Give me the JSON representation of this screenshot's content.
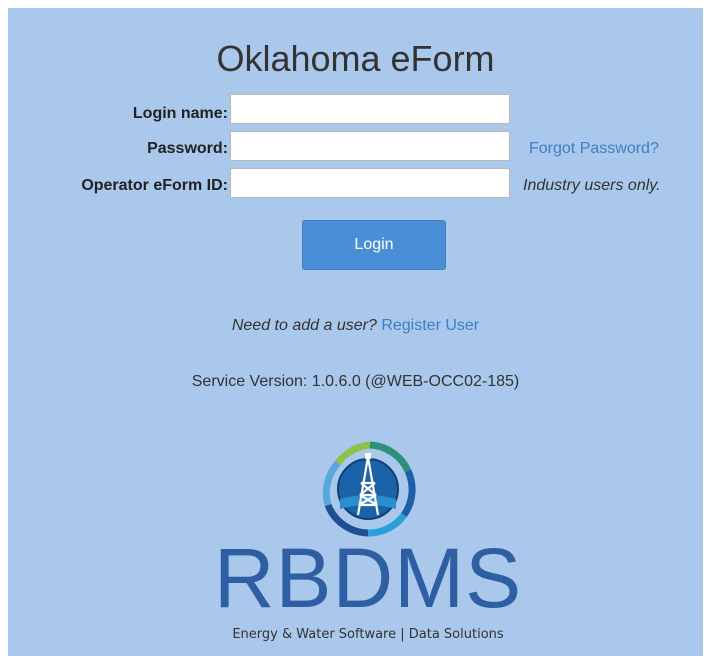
{
  "page": {
    "title": "Oklahoma eForm"
  },
  "form": {
    "login_name": {
      "label": "Login name:",
      "value": ""
    },
    "password": {
      "label": "Password:",
      "value": ""
    },
    "operator_id": {
      "label": "Operator eForm ID:",
      "value": ""
    },
    "forgot_password": "Forgot Password?",
    "industry_hint": "Industry users only.",
    "login_button": "Login"
  },
  "register": {
    "prompt": "Need to add a user?",
    "link": "Register User"
  },
  "service_version": "Service Version: 1.0.6.0 (@WEB-OCC02-185)",
  "logo": {
    "brand": "RBDMS",
    "tagline": "Energy & Water Software | Data Solutions",
    "icon": "oil-derrick-globe-icon"
  },
  "colors": {
    "background": "#a9c8eb",
    "accent": "#4a8fd6",
    "link": "#3d7ec8",
    "brand": "#2f5fa3"
  }
}
